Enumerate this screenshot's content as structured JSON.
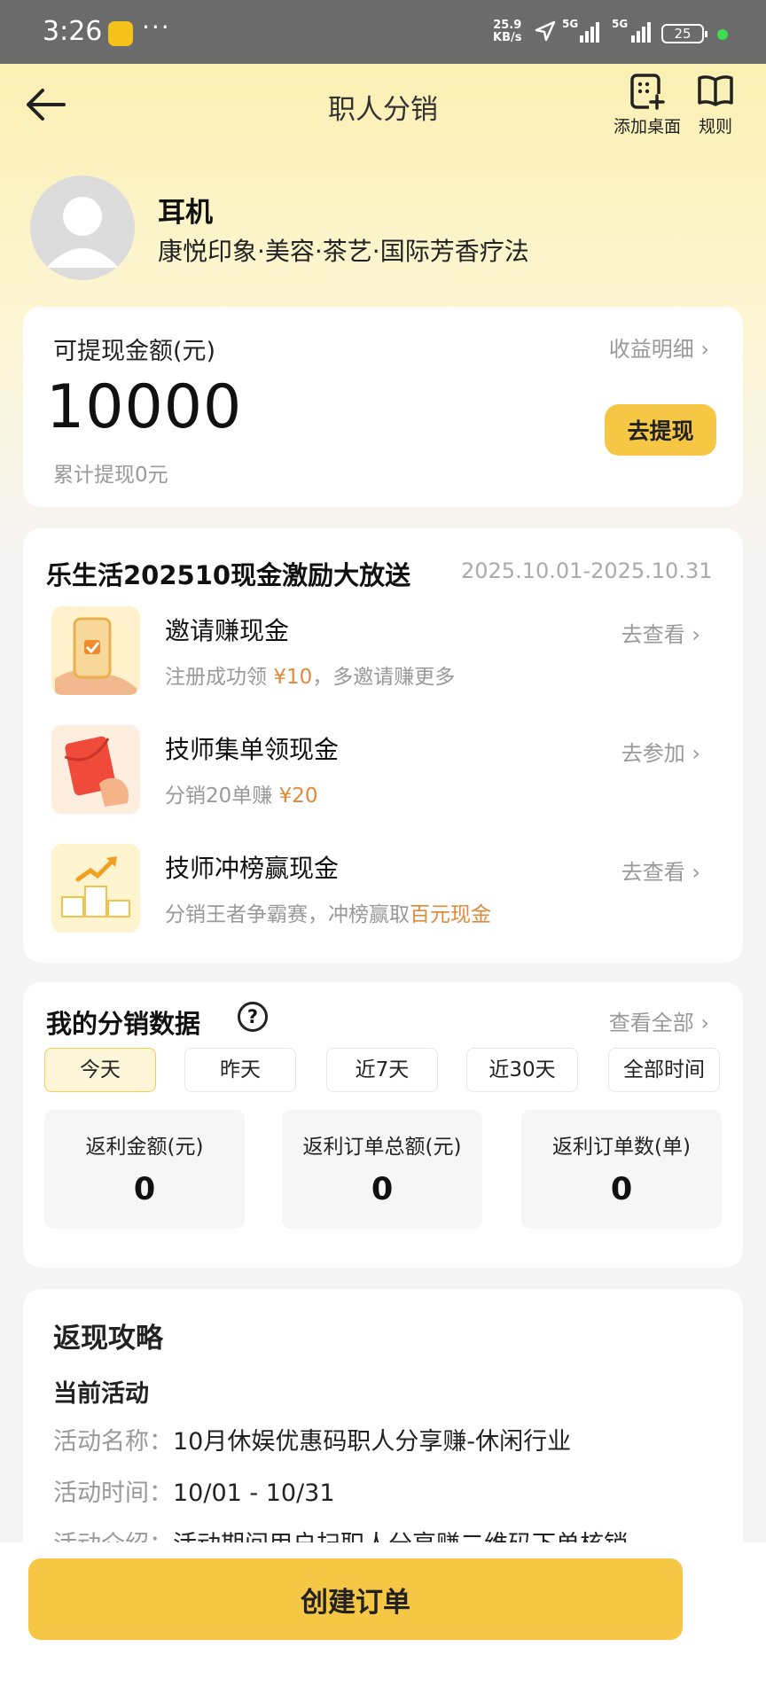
{
  "status_bar": {
    "time": "3:26",
    "more": "···",
    "speed_value": "25.9",
    "speed_unit": "KB/s",
    "signal1_label": "5G",
    "signal2_label": "5G",
    "battery": "25"
  },
  "header": {
    "title": "职人分销",
    "add_desktop_label": "添加桌面",
    "rules_label": "规则"
  },
  "profile": {
    "name": "耳机",
    "shop": "康悦印象·美容·茶艺·国际芳香疗法"
  },
  "wallet": {
    "label": "可提现金额(元)",
    "detail_link": "收益明细 ›",
    "amount": "10000",
    "total_withdrawn": "累计提现0元",
    "withdraw_button": "去提现"
  },
  "promo": {
    "title": "乐生活202510现金激励大放送",
    "date_range": "2025.10.01-2025.10.31",
    "items": [
      {
        "name": "邀请赚现金",
        "desc_pre": "注册成功领 ",
        "desc_hl": "¥10",
        "desc_post": "，多邀请赚更多",
        "link": "去查看 ›"
      },
      {
        "name": "技师集单领现金",
        "desc_pre": "分销20单赚 ",
        "desc_hl": "¥20",
        "desc_post": "",
        "link": "去参加 ›"
      },
      {
        "name": "技师冲榜赢现金",
        "desc_pre": "分销王者争霸赛，冲榜赢取",
        "desc_hl": "百元现金",
        "desc_post": "",
        "link": "去查看 ›"
      }
    ]
  },
  "stats": {
    "title": "我的分销数据",
    "help": "?",
    "view_all": "查看全部 ›",
    "periods": [
      "今天",
      "昨天",
      "近7天",
      "近30天",
      "全部时间"
    ],
    "active_period": "今天",
    "boxes": [
      {
        "label": "返利金额(元)",
        "value": "0"
      },
      {
        "label": "返利订单总额(元)",
        "value": "0"
      },
      {
        "label": "返利订单数(单)",
        "value": "0"
      }
    ]
  },
  "guide": {
    "title": "返现攻略",
    "subtitle": "当前活动",
    "rows": [
      {
        "key": "活动名称：",
        "value": "10月休娱优惠码职人分享赚-休闲行业"
      },
      {
        "key": "活动时间：",
        "value": "10/01 - 10/31"
      },
      {
        "key": "活动介绍：",
        "value": "活动期间用户扫职人分享赚二维码下单核销"
      }
    ]
  },
  "footer": {
    "create_order": "创建订单"
  },
  "colors": {
    "accent": "#f6c744",
    "highlight": "#e08a3a",
    "hero_bg": "#fbf0b3"
  }
}
